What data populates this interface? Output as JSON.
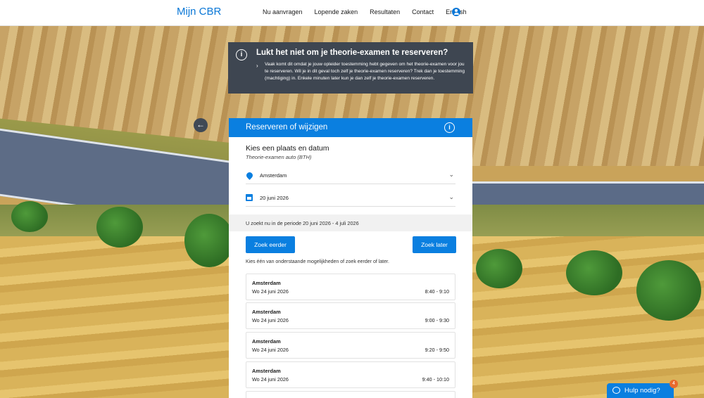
{
  "header": {
    "brand": "Mijn CBR",
    "nav": [
      "Nu aanvragen",
      "Lopende zaken",
      "Resultaten",
      "Contact",
      "English"
    ]
  },
  "banner": {
    "title": "Lukt het niet om je theorie-examen te reserveren?",
    "text": "Vaak komt dit omdat je jouw opleider toestemming hebt gegeven om het theorie-examen voor jou te reserveren. Wil je in dit geval toch zelf je theorie-examen reserveren? Trek dan je toestemming (machtiging) in. Enkele minuten later kun je dan zelf je theorie-examen reserveren."
  },
  "card": {
    "title": "Reserveren of wijzigen",
    "subtitle": "Kies een plaats en datum",
    "exam_type": "Theorie-examen auto (BTH)",
    "location": "Amsterdam",
    "date": "20 juni 2026",
    "period": "U zoekt nu in de periode 20 juni 2026 - 4 juli 2026",
    "earlier_label": "Zoek eerder",
    "later_label": "Zoek later",
    "hint": "Kies één van onderstaande mogelijkheden of zoek eerder of later.",
    "slots": [
      {
        "location": "Amsterdam",
        "date": "Wo 24 juni 2026",
        "time": "8:40 - 9:10"
      },
      {
        "location": "Amsterdam",
        "date": "Wo 24 juni 2026",
        "time": "9:00 - 9:30"
      },
      {
        "location": "Amsterdam",
        "date": "Wo 24 juni 2026",
        "time": "9:20 - 9:50"
      },
      {
        "location": "Amsterdam",
        "date": "Wo 24 juni 2026",
        "time": "9:40 - 10:10"
      }
    ]
  },
  "help": {
    "label": "Hulp nodig?",
    "badge": "4"
  },
  "colors": {
    "accent": "#0a7fe0",
    "banner_bg": "#3e4651",
    "badge": "#e96b2e"
  }
}
